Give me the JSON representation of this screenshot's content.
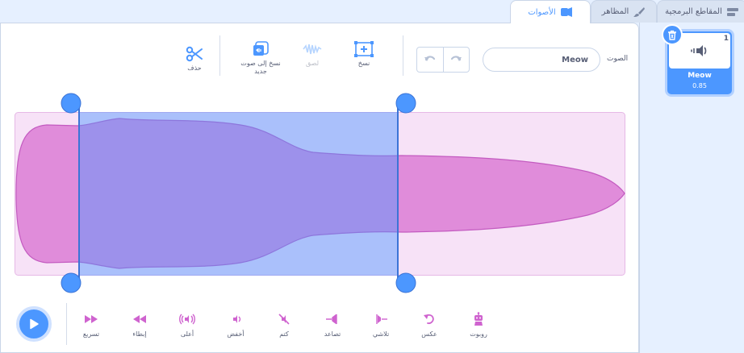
{
  "tabs": [
    {
      "label": "المقاطع البرمجية",
      "icon": "code-icon"
    },
    {
      "label": "المظاهر",
      "icon": "brush-icon"
    },
    {
      "label": "الأصوات",
      "icon": "sound-icon"
    }
  ],
  "toolbar": {
    "sound_label": "الصوت",
    "sound_name": "Meow",
    "undo_icon": "undo-icon",
    "redo_icon": "redo-icon",
    "copy_label": "نسخ",
    "paste_label": "لصق",
    "copy_new_label": "نسخ إلى صوت جديد",
    "delete_label": "حذف"
  },
  "sound_tile": {
    "number": "1",
    "name": "Meow",
    "duration": "0.85"
  },
  "effects": [
    {
      "label": "تسريع",
      "icon": "faster-icon"
    },
    {
      "label": "إبطاء",
      "icon": "slower-icon"
    },
    {
      "label": "أعلى",
      "icon": "louder-icon"
    },
    {
      "label": "أخفض",
      "icon": "softer-icon"
    },
    {
      "label": "كتم",
      "icon": "mute-icon"
    },
    {
      "label": "تصاعد",
      "icon": "fade-in-icon"
    },
    {
      "label": "تلاشي",
      "icon": "fade-out-icon"
    },
    {
      "label": "عكس",
      "icon": "reverse-icon"
    },
    {
      "label": "روبوت",
      "icon": "robot-icon"
    }
  ],
  "colors": {
    "accent": "#4c97ff",
    "sound": "#cf63cf",
    "selection": "#4c97ff"
  },
  "selection": {
    "start": 0.105,
    "end": 0.627
  }
}
